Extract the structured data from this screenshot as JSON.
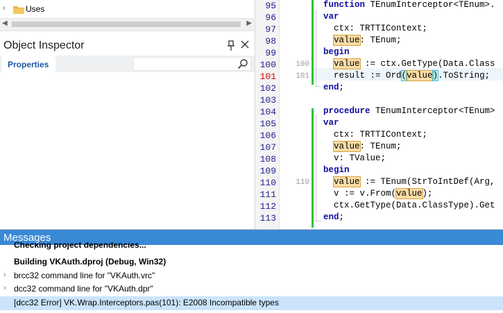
{
  "project_tree": {
    "item_label": "Uses"
  },
  "object_inspector": {
    "title": "Object Inspector",
    "tab_label": "Properties",
    "search_placeholder": ""
  },
  "editor": {
    "lines": [
      {
        "n": "95",
        "dbg": "",
        "html_key": "l95"
      },
      {
        "n": "96",
        "dbg": "",
        "html_key": "l96"
      },
      {
        "n": "97",
        "dbg": "",
        "html_key": "l97"
      },
      {
        "n": "98",
        "dbg": "",
        "html_key": "l98"
      },
      {
        "n": "99",
        "dbg": "",
        "html_key": "l99"
      },
      {
        "n": "100",
        "dbg": "100",
        "html_key": "l100"
      },
      {
        "n": "101",
        "dbg": "101",
        "html_key": "l101"
      },
      {
        "n": "102",
        "dbg": "",
        "html_key": "l102"
      },
      {
        "n": "103",
        "dbg": "",
        "html_key": "l103"
      },
      {
        "n": "104",
        "dbg": "",
        "html_key": "l104"
      },
      {
        "n": "105",
        "dbg": "",
        "html_key": "l105"
      },
      {
        "n": "106",
        "dbg": "",
        "html_key": "l106"
      },
      {
        "n": "107",
        "dbg": "",
        "html_key": "l107"
      },
      {
        "n": "108",
        "dbg": "",
        "html_key": "l108"
      },
      {
        "n": "109",
        "dbg": "",
        "html_key": "l109"
      },
      {
        "n": "110",
        "dbg": "110",
        "html_key": "l110"
      },
      {
        "n": "111",
        "dbg": "",
        "html_key": "l111"
      },
      {
        "n": "112",
        "dbg": "",
        "html_key": "l112"
      },
      {
        "n": "113",
        "dbg": "",
        "html_key": "l113"
      }
    ],
    "current_line": "101",
    "code": {
      "l95_kw": "function",
      "l95_rest": " TEnumInterceptor<TEnum>.",
      "l96_kw": "var",
      "l97": "ctx: TRTTIContext;",
      "l98_hl": "value",
      "l98_rest": ": TEnum;",
      "l99_kw": "begin",
      "l100_hl": "value",
      "l100_rest": " := ctx.GetType(Data.Class",
      "l101_a": "result := Ord",
      "l101_b1": "(",
      "l101_hl": "value",
      "l101_b2": ")",
      "l101_rest": ".ToString;",
      "l102_kw": "end",
      "l102_rest": ";",
      "l104_kw": "procedure",
      "l104_rest": " TEnumInterceptor<TEnum>",
      "l105_kw": "var",
      "l106": "ctx: TRTTIContext;",
      "l107_hl": "value",
      "l107_rest": ": TEnum;",
      "l108": "v: TValue;",
      "l109_kw": "begin",
      "l110_hl": "value",
      "l110_rest": " := TEnum(StrToIntDef(Arg,",
      "l111_a": "v := v.From(",
      "l111_hl": "value",
      "l111_rest": ");",
      "l112": "ctx.GetType(Data.ClassType).Get",
      "l113_kw": "end",
      "l113_rest": ";"
    }
  },
  "messages": {
    "title": "Messages",
    "items": [
      {
        "text": "Checking project dependencies...",
        "bold": true,
        "expandable": false
      },
      {
        "text": "Building VKAuth.dproj (Debug, Win32)",
        "bold": true,
        "expandable": false
      },
      {
        "text": "brcc32 command line for \"VKAuth.vrc\"",
        "bold": false,
        "expandable": true
      },
      {
        "text": "dcc32 command line for \"VKAuth.dpr\"",
        "bold": false,
        "expandable": true
      },
      {
        "text": "[dcc32 Error] VK.Wrap.Interceptors.pas(101): E2008 Incompatible types",
        "bold": false,
        "expandable": false,
        "selected": true
      }
    ]
  },
  "colors": {
    "accent": "#3a89d6",
    "keyword": "#0e0ea0",
    "current_line_number": "#e00000",
    "modified_bar": "#2ec03a",
    "highlight": "#fbdca6",
    "selection": "#cbe4fb"
  }
}
